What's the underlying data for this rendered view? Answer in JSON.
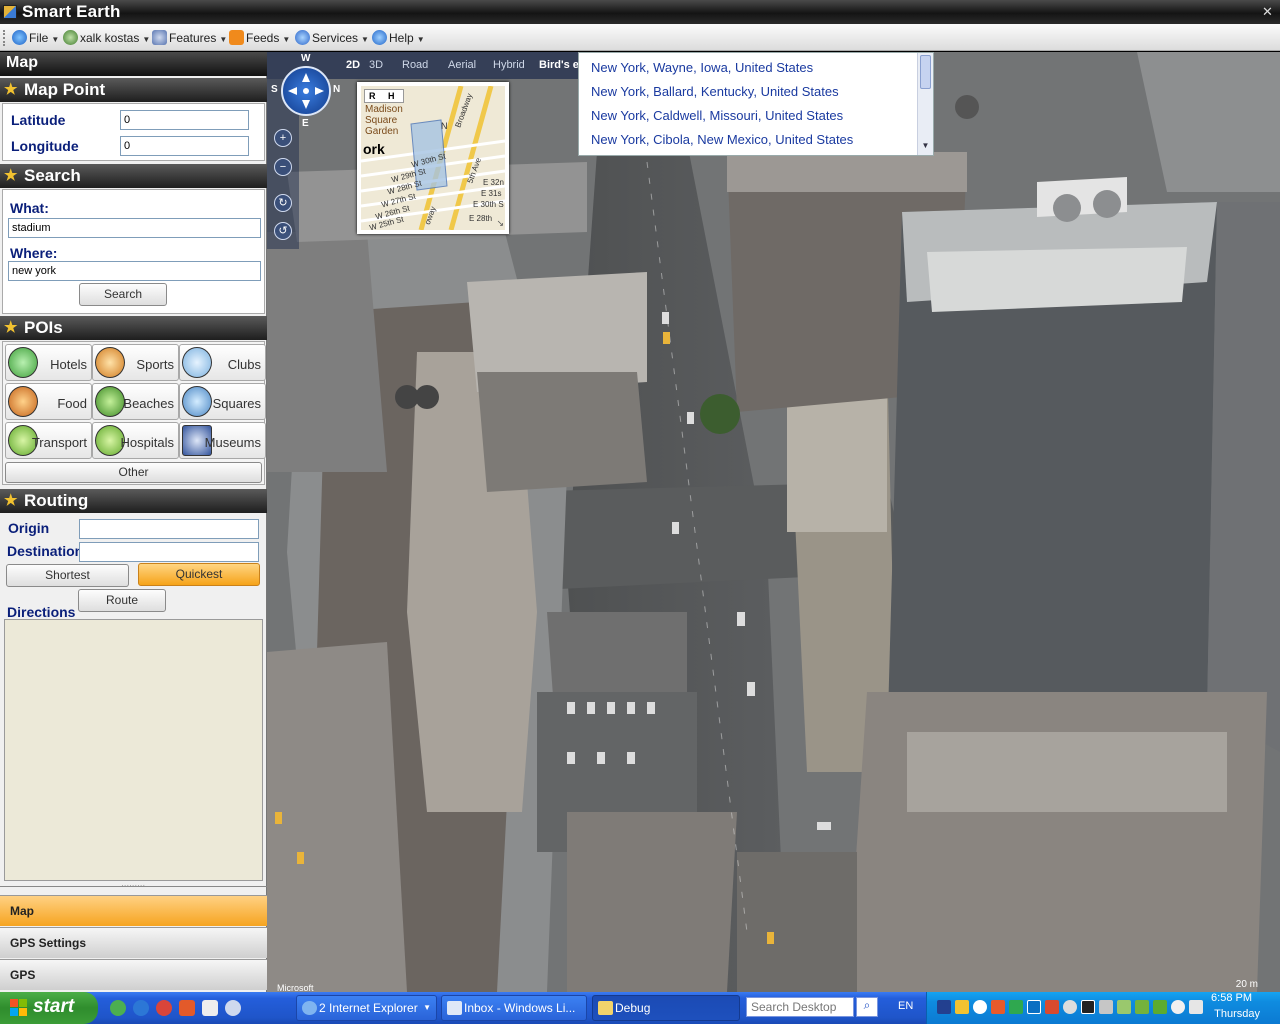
{
  "window": {
    "title": "Smart Earth",
    "close_glyph": "✕"
  },
  "menu": [
    {
      "label": "File",
      "icon": "globe-icon"
    },
    {
      "label": "xalk kostas",
      "icon": "user-icon"
    },
    {
      "label": "Features",
      "icon": "features-icon"
    },
    {
      "label": "Feeds",
      "icon": "rss-icon"
    },
    {
      "label": "Services",
      "icon": "services-icon"
    },
    {
      "label": "Help",
      "icon": "help-icon"
    }
  ],
  "left_panel": {
    "title": "Map",
    "map_point": {
      "header": "Map Point",
      "latitude_label": "Latitude",
      "latitude_value": "0",
      "longitude_label": "Longitude",
      "longitude_value": "0"
    },
    "search": {
      "header": "Search",
      "what_label": "What:",
      "what_value": "stadium",
      "where_label": "Where:",
      "where_value": "new york",
      "button": "Search"
    },
    "pois": {
      "header": "POIs",
      "items": [
        {
          "label": "Hotels",
          "icon": "hotel-icon",
          "color": "#5cb85c"
        },
        {
          "label": "Sports",
          "icon": "sports-icon",
          "color": "#e8a23a"
        },
        {
          "label": "Clubs",
          "icon": "clubs-icon",
          "color": "#9ec6ea"
        },
        {
          "label": "Food",
          "icon": "food-icon",
          "color": "#e58b2f"
        },
        {
          "label": "Beaches",
          "icon": "beaches-icon",
          "color": "#4fa63c"
        },
        {
          "label": "Squares",
          "icon": "squares-icon",
          "color": "#6aa6d8"
        },
        {
          "label": "Transport",
          "icon": "transport-icon",
          "color": "#7cc242"
        },
        {
          "label": "Hospitals",
          "icon": "hospital-icon",
          "color": "#7cc242"
        },
        {
          "label": "Museums",
          "icon": "museum-icon",
          "color": "#3d5ca8"
        }
      ],
      "other_button": "Other"
    },
    "routing": {
      "header": "Routing",
      "origin_label": "Origin",
      "origin_value": "",
      "destination_label": "Destination",
      "destination_value": "",
      "shortest_button": "Shortest",
      "quickest_button": "Quickest",
      "route_button": "Route",
      "directions_label": "Directions"
    },
    "dock": [
      "Map",
      "GPS Settings",
      "GPS"
    ]
  },
  "map": {
    "modes": [
      "2D",
      "3D",
      "Road",
      "Aerial",
      "Hybrid",
      "Bird's e"
    ],
    "active_modes": [
      "2D",
      "Bird's e"
    ],
    "compass": {
      "n": "W",
      "s": "E",
      "w": "S",
      "e": "N"
    },
    "minimap_labels": [
      "R",
      "H",
      "Madison",
      "Square",
      "Garden",
      "ork",
      "W 30th St",
      "W 29th St",
      "W 28th St",
      "W 27th St",
      "W 26th St",
      "W 25th St",
      "5th Ave",
      "E 32n",
      "E 31s",
      "E 30th S",
      "E 28th",
      "Broadway",
      "oway",
      "N"
    ],
    "suggestions": [
      "New York, Wayne, Iowa, United States",
      "New York, Ballard, Kentucky, United States",
      "New York, Caldwell, Missouri, United States",
      "New York, Cibola, New Mexico, United States"
    ],
    "credit": "Microsoft",
    "scale": "20 m"
  },
  "taskbar": {
    "start_label": "start",
    "tasks": [
      {
        "label": "2 Internet Explorer",
        "icon": "ie-icon"
      },
      {
        "label": "Inbox - Windows Li...",
        "icon": "mail-icon"
      },
      {
        "label": "Debug",
        "icon": "folder-icon"
      }
    ],
    "search_placeholder": "Search Desktop",
    "language": "EN",
    "time": "6:58 PM",
    "day": "Thursday"
  },
  "colors": {
    "accent_orange": "#f6a319",
    "label_blue": "#0a1f7a",
    "link_blue": "#1a3aa0"
  }
}
